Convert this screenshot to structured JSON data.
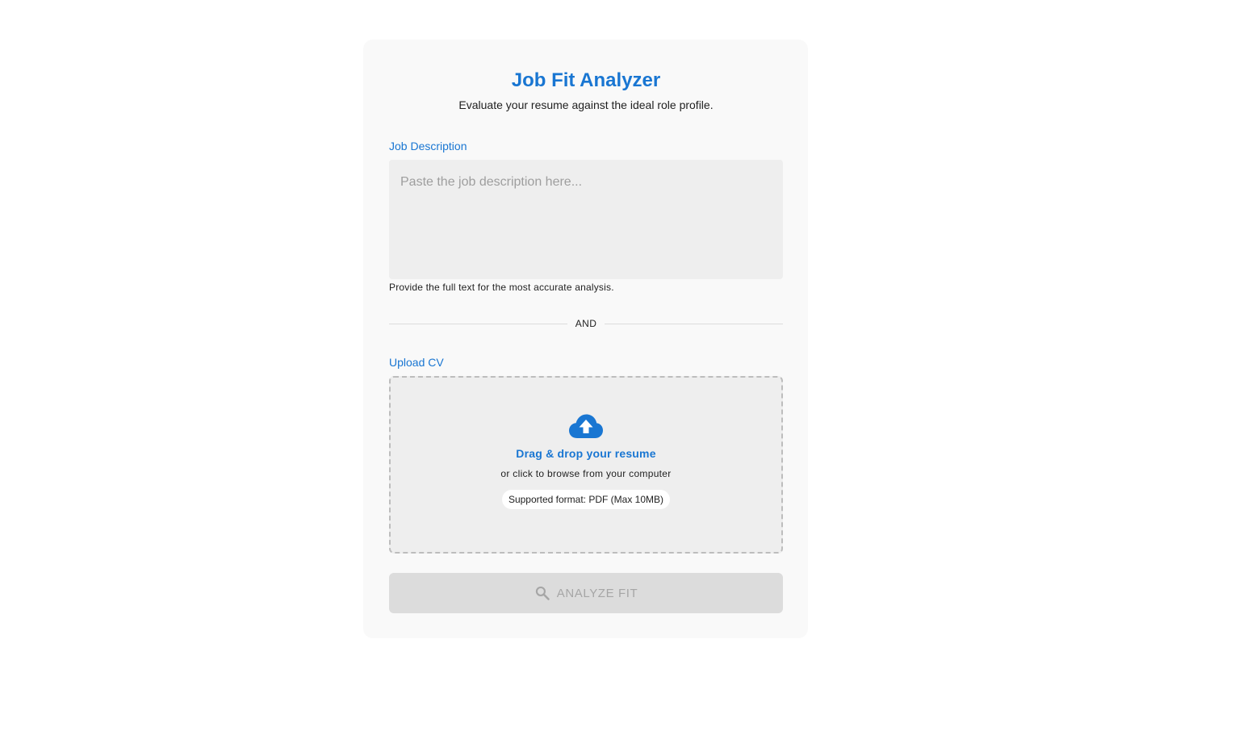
{
  "header": {
    "title": "Job Fit Analyzer",
    "subtitle": "Evaluate your resume against the ideal role profile."
  },
  "job_description": {
    "label": "Job Description",
    "value": "",
    "placeholder": "Paste the job description here...",
    "helper": "Provide the full text for the most accurate analysis."
  },
  "divider": {
    "text": "AND"
  },
  "upload": {
    "label": "Upload CV",
    "icon": "cloud-upload-icon",
    "title": "Drag & drop your resume",
    "subtitle": "or click to browse from your computer",
    "format": "Supported format: PDF (Max 10MB)"
  },
  "analyze_button": {
    "icon": "search-icon",
    "label": "ANALYZE FIT",
    "disabled": true
  },
  "colors": {
    "accent": "#1976d2",
    "card_bg": "#f9f9f9",
    "field_bg": "#eeeeee",
    "button_disabled_bg": "#dcdcdc",
    "button_disabled_text": "#a6a6a6"
  }
}
